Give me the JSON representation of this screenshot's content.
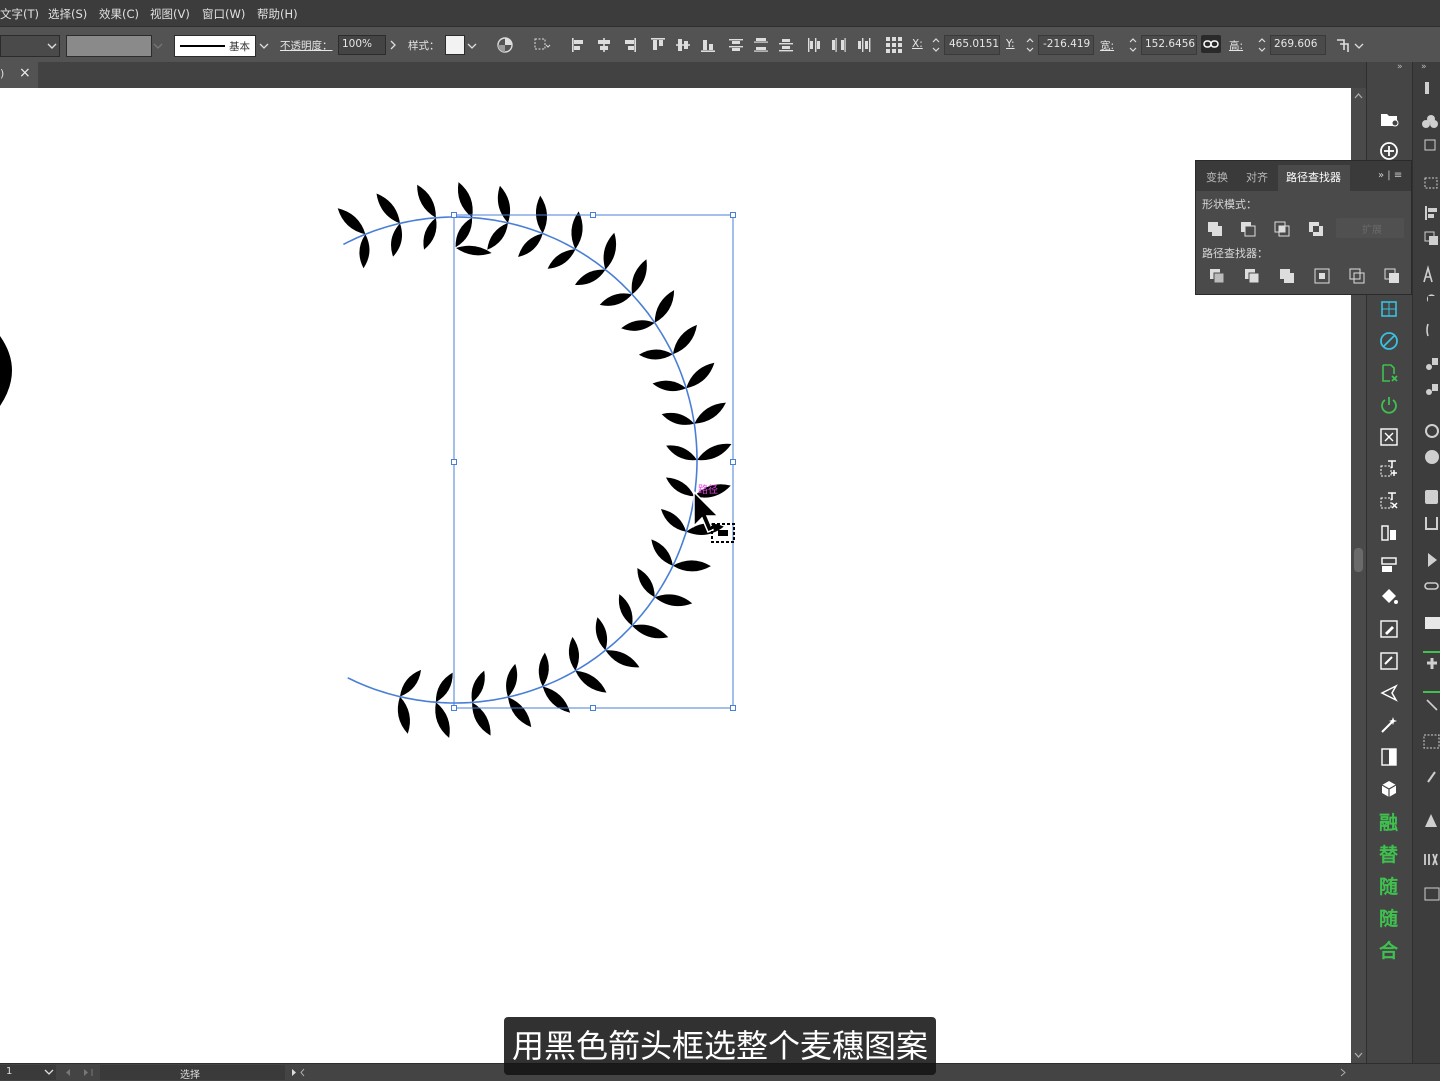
{
  "menu": [
    "文字(T)",
    "选择(S)",
    "效果(C)",
    "视图(V)",
    "窗口(W)",
    "帮助(H)"
  ],
  "control_bar": {
    "stroke_style": "基本",
    "opacity_label": "不透明度：",
    "opacity_value": "100%",
    "style_label": "样式：",
    "x_label": "X:",
    "x_value": "465.0151",
    "y_label": "Y:",
    "y_value": "-216.419",
    "w_label": "宽:",
    "w_value": "152.6456",
    "h_label": "高:",
    "h_value": "269.606"
  },
  "tabs": {
    "doc_fragment": ")",
    "close": "×"
  },
  "canvas": {
    "hover_label": "路径"
  },
  "pathfinder_panel": {
    "tabs": [
      "变换",
      "对齐",
      "路径查找器"
    ],
    "shape_modes_label": "形状模式：",
    "expand_label": "扩展",
    "pathfinders_label": "路径查找器："
  },
  "dock_plugins": [
    "融",
    "替",
    "随",
    "随",
    "合"
  ],
  "status_bar": {
    "page_value": "1",
    "tool_name": "选择"
  },
  "subtitle": "用黑色箭头框选整个麦穗图案",
  "colors": {
    "selection": "#4a7fd6",
    "plugin_green": "#3fc04f",
    "hover_label": "#e040e0"
  }
}
